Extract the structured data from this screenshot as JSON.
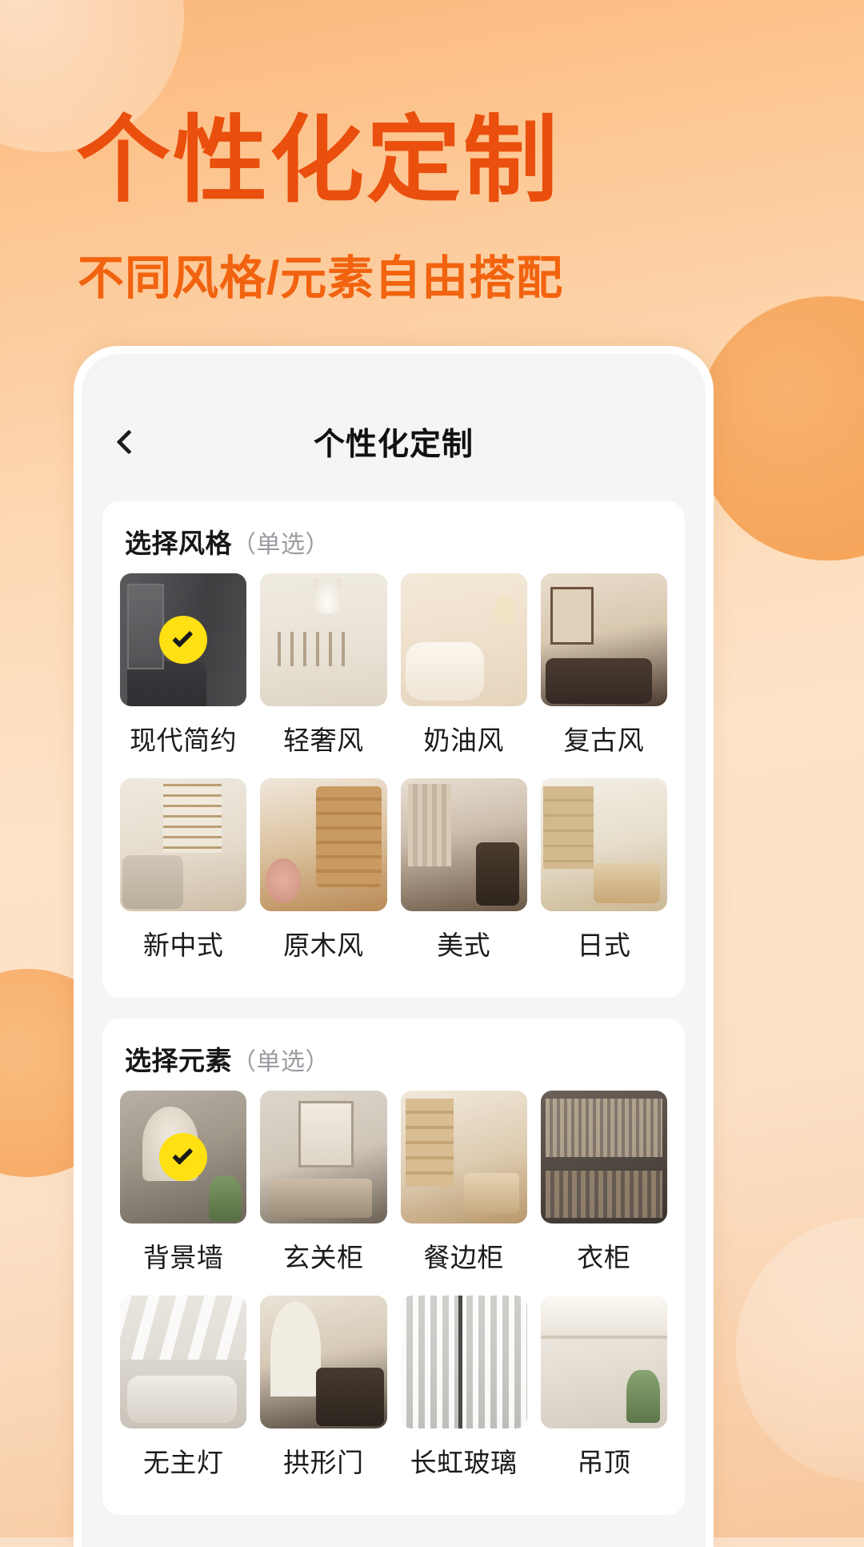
{
  "hero": {
    "title": "个性化定制",
    "subtitle": "不同风格/元素自由搭配",
    "title_color": "#ea4f0d",
    "subtitle_color": "#f2630f",
    "background_color": "#fbe0c8"
  },
  "phone": {
    "navbar": {
      "back_icon": "chevron-left-icon",
      "title": "个性化定制"
    },
    "sections": [
      {
        "title": "选择风格",
        "note": "（单选）",
        "items": [
          {
            "label": "现代简约",
            "art": "a-modern",
            "selected": true
          },
          {
            "label": "轻奢风",
            "art": "a-luxury",
            "selected": false
          },
          {
            "label": "奶油风",
            "art": "a-cream",
            "selected": false
          },
          {
            "label": "复古风",
            "art": "a-retro",
            "selected": false
          },
          {
            "label": "新中式",
            "art": "a-chinese",
            "selected": false
          },
          {
            "label": "原木风",
            "art": "a-wood",
            "selected": false
          },
          {
            "label": "美式",
            "art": "a-american",
            "selected": false
          },
          {
            "label": "日式",
            "art": "a-japanese",
            "selected": false
          }
        ]
      },
      {
        "title": "选择元素",
        "note": "（单选）",
        "items": [
          {
            "label": "背景墙",
            "art": "a-bgwall",
            "selected": true
          },
          {
            "label": "玄关柜",
            "art": "a-entry",
            "selected": false
          },
          {
            "label": "餐边柜",
            "art": "a-sidecab",
            "selected": false
          },
          {
            "label": "衣柜",
            "art": "a-wardrobe",
            "selected": false
          },
          {
            "label": "无主灯",
            "art": "a-nolight",
            "selected": false
          },
          {
            "label": "拱形门",
            "art": "a-arch",
            "selected": false
          },
          {
            "label": "长虹玻璃",
            "art": "a-glass",
            "selected": false
          },
          {
            "label": "吊顶",
            "art": "a-ceiling",
            "selected": false
          }
        ]
      }
    ],
    "selected_badge": {
      "icon": "check-icon",
      "color": "#ffe013"
    }
  }
}
